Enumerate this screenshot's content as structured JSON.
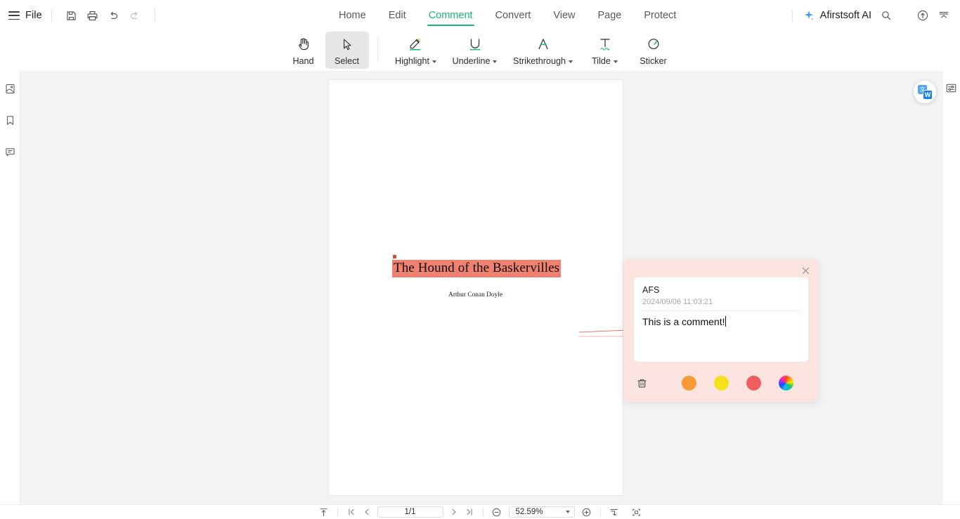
{
  "app": {
    "file_menu_label": "File",
    "ai_label": "Afirstsoft AI"
  },
  "topbar": {
    "quick_actions": [
      {
        "name": "save-icon",
        "tooltip": "Save"
      },
      {
        "name": "print-icon",
        "tooltip": "Print"
      },
      {
        "name": "undo-icon",
        "tooltip": "Undo"
      },
      {
        "name": "redo-icon",
        "tooltip": "Redo"
      }
    ],
    "tabs": [
      {
        "label": "Home",
        "active": false
      },
      {
        "label": "Edit",
        "active": false
      },
      {
        "label": "Comment",
        "active": true
      },
      {
        "label": "Convert",
        "active": false
      },
      {
        "label": "View",
        "active": false
      },
      {
        "label": "Page",
        "active": false
      },
      {
        "label": "Protect",
        "active": false
      }
    ],
    "active_tab_color": "#17b877",
    "right_actions": [
      {
        "name": "search-icon"
      },
      {
        "name": "cloud-upload-icon"
      },
      {
        "name": "collapse-ribbon-icon"
      }
    ]
  },
  "ribbon": {
    "tools": [
      {
        "label": "Hand",
        "icon": "hand-icon",
        "active": false,
        "has_caret": false
      },
      {
        "label": "Select",
        "icon": "cursor-arrow-icon",
        "active": true,
        "has_caret": false
      },
      {
        "label": "Highlight",
        "icon": "highlighter-icon",
        "active": false,
        "has_caret": true
      },
      {
        "label": "Underline",
        "icon": "underline-icon",
        "active": false,
        "has_caret": true
      },
      {
        "label": "Strikethrough",
        "icon": "strikethrough-icon",
        "active": false,
        "has_caret": true
      },
      {
        "label": "Tilde",
        "icon": "tilde-icon",
        "active": false,
        "has_caret": true
      },
      {
        "label": "Sticker",
        "icon": "sticker-icon",
        "active": false,
        "has_caret": false
      }
    ]
  },
  "left_rail": {
    "items": [
      {
        "name": "page-thumbnails-icon"
      },
      {
        "name": "bookmarks-icon"
      },
      {
        "name": "comments-panel-icon"
      }
    ]
  },
  "document": {
    "title": "The Hound of the Baskervilles",
    "author": "Arthur Conan Doyle",
    "highlight_color": "#f0806f",
    "anchor_color": "#d4493a",
    "connector_color": "#e8776a"
  },
  "floating": {
    "translate_icon": "translate-icon",
    "translate_glyph_a": "文",
    "translate_glyph_b": "W",
    "settings_icon": "settings-sliders-icon"
  },
  "comment_popup": {
    "author": "AFS",
    "timestamp": "2024/09/06 11:03:21",
    "text": "This is a comment!",
    "background": "#fbe3e0",
    "close_icon": "close-icon",
    "delete_icon": "trash-icon",
    "colors": [
      {
        "name": "color-orange",
        "hex": "#f79a36"
      },
      {
        "name": "color-yellow",
        "hex": "#f5e01e"
      },
      {
        "name": "color-red",
        "hex": "#ef5d5d"
      },
      {
        "name": "color-wheel",
        "hex": "rainbow"
      }
    ]
  },
  "bottombar": {
    "upload_icon": "upload-to-top-icon",
    "first_page_icon": "first-page-icon",
    "prev_page_icon": "prev-page-icon",
    "page_indicator": "1/1",
    "next_page_icon": "next-page-icon",
    "last_page_icon": "last-page-icon",
    "zoom_out_icon": "zoom-out-icon",
    "zoom_level": "52.59%",
    "zoom_in_icon": "zoom-in-icon",
    "fit_page_icon": "fit-page-icon",
    "fit_width_icon": "fit-width-icon"
  }
}
